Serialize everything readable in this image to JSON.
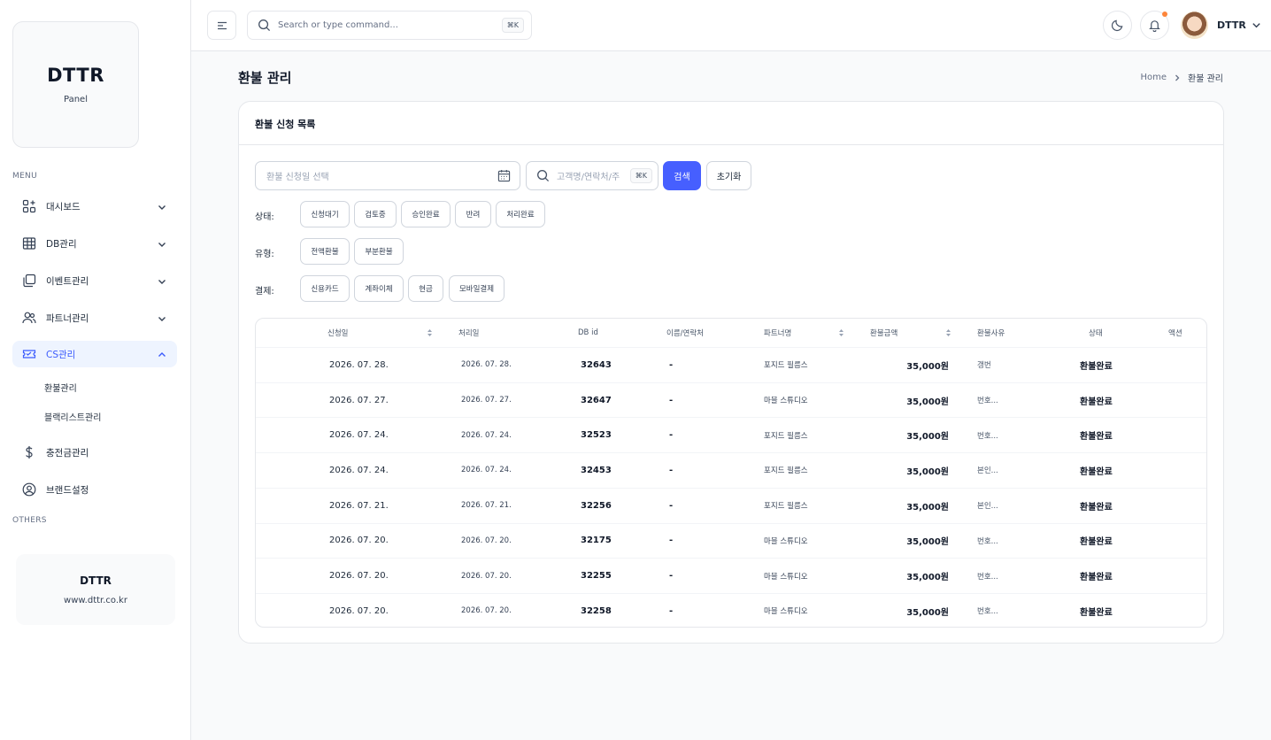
{
  "sidebar": {
    "logo_title": "DTTR",
    "logo_sub": "Panel",
    "menu_label": "MENU",
    "others_label": "OTHERS",
    "items": [
      {
        "label": "대시보드",
        "icon": "grid-plus-icon"
      },
      {
        "label": "DB관리",
        "icon": "table-icon"
      },
      {
        "label": "이벤트관리",
        "icon": "copy-icon"
      },
      {
        "label": "파트너관리",
        "icon": "users-icon"
      },
      {
        "label": "CS관리",
        "icon": "ticket-icon"
      },
      {
        "label": "충전금관리",
        "icon": "dollar-icon"
      },
      {
        "label": "브랜드설정",
        "icon": "user-circle-icon"
      }
    ],
    "sub_items": [
      "환불관리",
      "블랙리스트관리"
    ],
    "brand_name": "DTTR",
    "brand_url": "www.dttr.co.kr"
  },
  "header": {
    "search_placeholder": "Search or type command...",
    "search_shortcut": "⌘K",
    "user_name": "DTTR"
  },
  "page": {
    "title": "환불 관리",
    "breadcrumb_home": "Home",
    "breadcrumb_current": "환불 관리"
  },
  "card": {
    "title": "환불 신청 목록",
    "date_placeholder": "환불 신청일 선택",
    "search_placeholder": "고객명/연락처/주",
    "search_shortcut": "⌘K",
    "search_button": "검색",
    "reset_button": "초기화",
    "filters": {
      "status_label": "상태:",
      "status_options": [
        "신청대기",
        "검토중",
        "승인완료",
        "반려",
        "처리완료"
      ],
      "type_label": "유형:",
      "type_options": [
        "전액환불",
        "부분환불"
      ],
      "payment_label": "결제:",
      "payment_options": [
        "신용카드",
        "계좌이체",
        "현금",
        "모바일결제"
      ]
    }
  },
  "table": {
    "headers": [
      "신청일",
      "처리일",
      "DB id",
      "이름/연락처",
      "파트너명",
      "환불금액",
      "환불사유",
      "상태",
      "액션"
    ],
    "rows": [
      [
        "2026. 07. 28.",
        "2026. 07. 28.",
        "32643",
        "-",
        "포지드 필름스",
        "35,000원",
        "갱번",
        "환불완료"
      ],
      [
        "2026. 07. 27.",
        "2026. 07. 27.",
        "32647",
        "-",
        "마블 스튜디오",
        "35,000원",
        "번호...",
        "환불완료"
      ],
      [
        "2026. 07. 24.",
        "2026. 07. 24.",
        "32523",
        "-",
        "포지드 필름스",
        "35,000원",
        "번호...",
        "환불완료"
      ],
      [
        "2026. 07. 24.",
        "2026. 07. 24.",
        "32453",
        "-",
        "포지드 필름스",
        "35,000원",
        "본인...",
        "환불완료"
      ],
      [
        "2026. 07. 21.",
        "2026. 07. 21.",
        "32256",
        "-",
        "포지드 필름스",
        "35,000원",
        "본인...",
        "환불완료"
      ],
      [
        "2026. 07. 20.",
        "2026. 07. 20.",
        "32175",
        "-",
        "마블 스튜디오",
        "35,000원",
        "번호...",
        "환불완료"
      ],
      [
        "2026. 07. 20.",
        "2026. 07. 20.",
        "32255",
        "-",
        "마블 스튜디오",
        "35,000원",
        "번호...",
        "환불완료"
      ],
      [
        "2026. 07. 20.",
        "2026. 07. 20.",
        "32258",
        "-",
        "마블 스튜디오",
        "35,000원",
        "번호...",
        "환불완료"
      ]
    ]
  },
  "colors": {
    "accent": "#465fff",
    "active_bg": "#eef4ff",
    "notification": "#fd853a"
  }
}
